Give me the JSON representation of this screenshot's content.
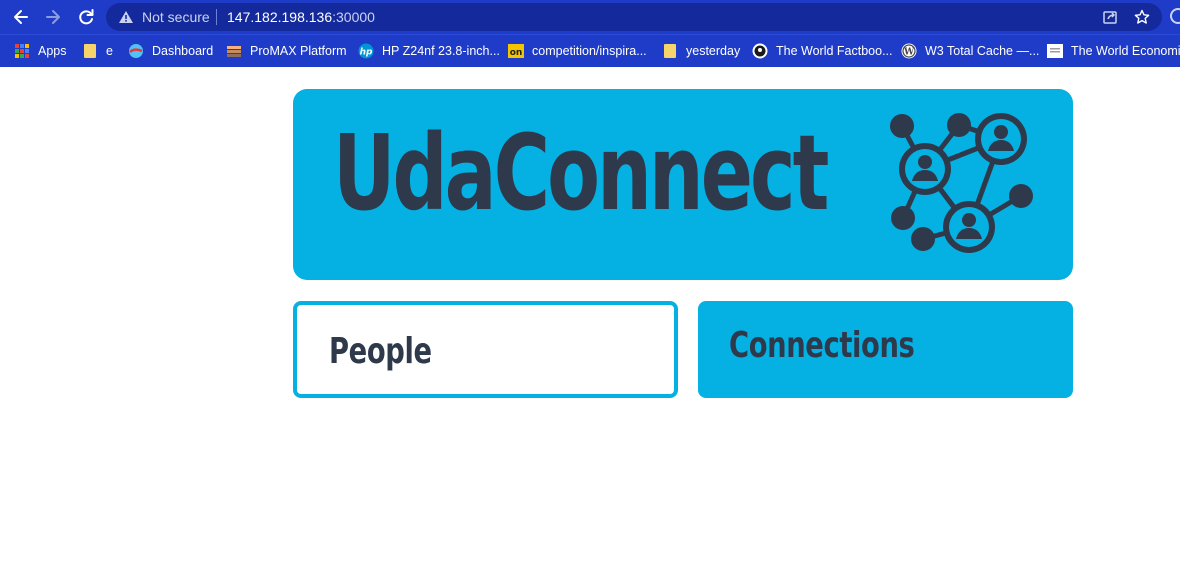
{
  "browser": {
    "security_label": "Not secure",
    "url_host": "147.182.198.136",
    "url_port": ":30000",
    "bookmarks": [
      {
        "label": "Apps",
        "icon": "apps-grid-icon"
      },
      {
        "label": "e",
        "icon": "folder-icon"
      },
      {
        "label": "Dashboard",
        "icon": "dashboard-icon"
      },
      {
        "label": "ProMAX Platform",
        "icon": "promax-icon"
      },
      {
        "label": "HP Z24nf 23.8-inch...",
        "icon": "hp-icon"
      },
      {
        "label": "competition/inspira...",
        "icon": "on-icon"
      },
      {
        "label": "yesterday",
        "icon": "folder-icon"
      },
      {
        "label": "The World Factboo...",
        "icon": "cia-seal-icon"
      },
      {
        "label": "W3 Total Cache —...",
        "icon": "wordpress-icon"
      },
      {
        "label": "The World Economi...",
        "icon": "page-icon"
      }
    ]
  },
  "app": {
    "title": "UdaConnect",
    "cards": [
      {
        "label": "People"
      },
      {
        "label": "Connections"
      }
    ]
  },
  "colors": {
    "accent": "#05b1e2",
    "text_dark": "#2e3a4c",
    "chrome": "#1e3cc8"
  }
}
